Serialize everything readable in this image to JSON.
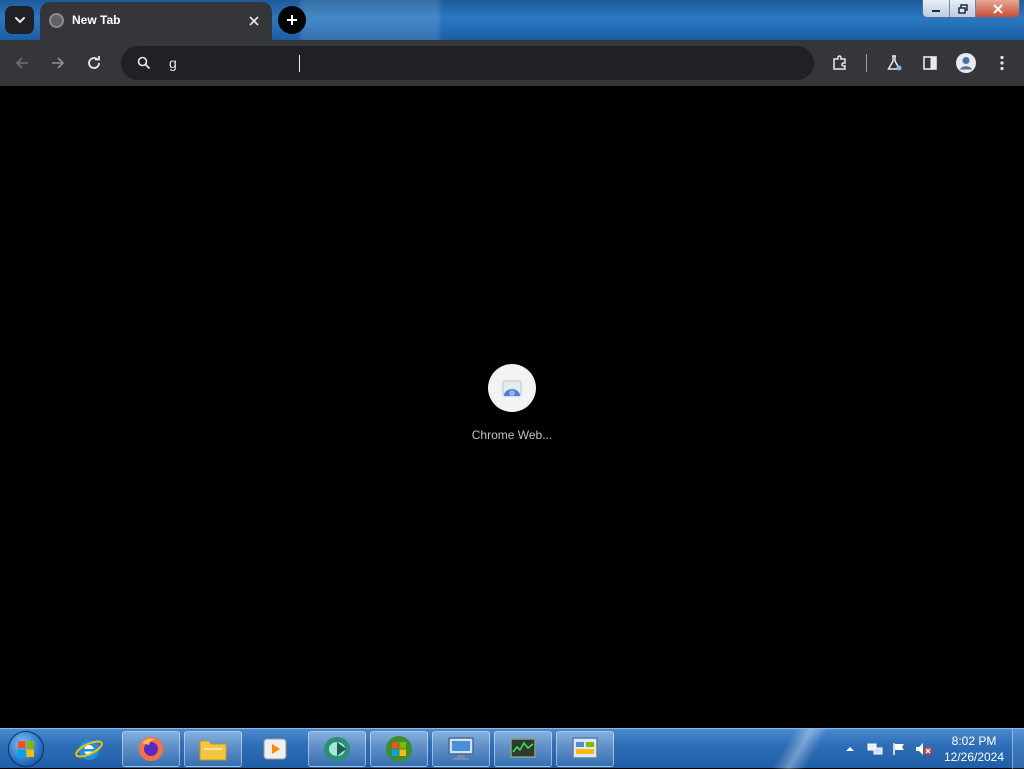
{
  "browser": {
    "tab": {
      "title": "New Tab"
    },
    "omnibox": {
      "value": "g"
    },
    "shortcut": {
      "label": "Chrome Web..."
    }
  },
  "icons": {
    "tab_search": "chevron-down-icon",
    "new_tab": "plus-icon",
    "back": "arrow-left-icon",
    "forward": "arrow-right-icon",
    "reload": "reload-icon",
    "search": "search-icon",
    "extensions": "puzzle-icon",
    "labs": "flask-icon",
    "side_panel": "side-panel-icon",
    "profile": "profile-icon",
    "menu": "kebab-menu-icon"
  },
  "taskbar": {
    "apps": [
      "internet-explorer",
      "firefox",
      "file-explorer",
      "media-player",
      "app",
      "windows",
      "computer",
      "task-manager",
      "control-panel"
    ],
    "clock": {
      "time": "8:02 PM",
      "date": "12/26/2024"
    }
  },
  "colors": {
    "tab_active": "#35363a",
    "toolbar": "#35363a",
    "omnibox": "#202124",
    "page_bg": "#000000",
    "accent_blue": "#8ab4f8"
  }
}
